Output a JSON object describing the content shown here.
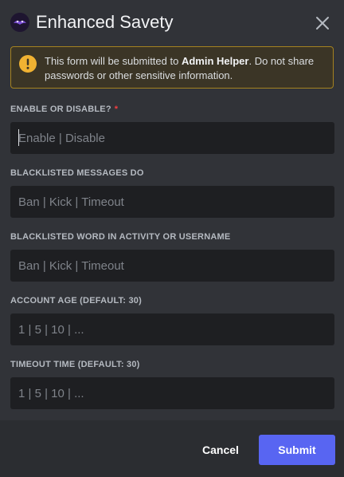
{
  "header": {
    "title": "Enhanced Savety",
    "app_icon": "bot-avatar-icon",
    "close_icon": "close-icon"
  },
  "notice": {
    "icon": "warning-icon",
    "text_before": "This form will be submitted to ",
    "app_name": "Admin Helper",
    "text_after": ". Do not share passwords or other sensitive information.",
    "accent_color": "#f0b232"
  },
  "form": {
    "fields": [
      {
        "label": "ENABLE OR DISABLE?",
        "required": "*",
        "placeholder": "Enable | Disable",
        "value": ""
      },
      {
        "label": "BLACKLISTED MESSAGES DO",
        "placeholder": "Ban | Kick | Timeout",
        "value": ""
      },
      {
        "label": "BLACKLISTED WORD IN ACTIVITY OR USERNAME",
        "placeholder": "Ban | Kick | Timeout",
        "value": ""
      },
      {
        "label": "ACCOUNT AGE (DEFAULT: 30)",
        "placeholder": "1 | 5 | 10 | ...",
        "value": ""
      },
      {
        "label": "TIMEOUT TIME (DEFAULT: 30)",
        "placeholder": "1 | 5 | 10 | ...",
        "value": ""
      }
    ]
  },
  "footer": {
    "cancel_label": "Cancel",
    "submit_label": "Submit",
    "submit_color": "#5865f2"
  }
}
